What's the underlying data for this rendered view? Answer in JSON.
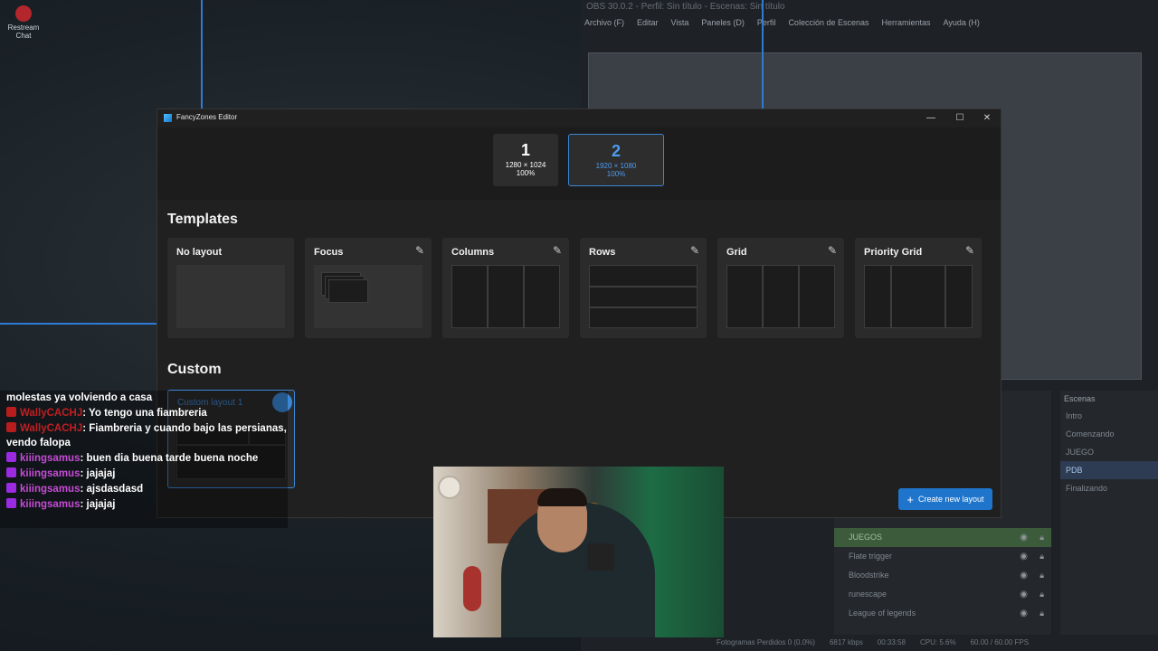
{
  "desktop": {
    "icon_label": "Restream Chat"
  },
  "obs": {
    "title": "OBS 30.0.2 - Perfil: Sin título - Escenas: Sin título",
    "menu": [
      "Archivo (F)",
      "Editar",
      "Vista",
      "Paneles (D)",
      "Perfil",
      "Colección de Escenas",
      "Herramientas",
      "Ayuda (H)"
    ],
    "sources": [
      "JUEGOS",
      "Flate trigger",
      "Bloodstrike",
      "runescape",
      "League of legends"
    ],
    "scenes_title": "Escenas",
    "scenes": [
      "Intro",
      "Comenzando",
      "JUEGO",
      "PDB",
      "Finalizando"
    ],
    "status": [
      "Fotogramas Perdidos 0 (0.0%)",
      "6817 kbps",
      "00:33:58",
      "CPU: 5.6%",
      "60.00 / 60.00 FPS"
    ]
  },
  "editor": {
    "title": "FancyZones Editor",
    "monitors": [
      {
        "number": "1",
        "resolution": "1280 × 1024",
        "scale": "100%"
      },
      {
        "number": "2",
        "resolution": "1920 × 1080",
        "scale": "100%"
      }
    ],
    "templates_heading": "Templates",
    "templates": [
      {
        "label": "No layout"
      },
      {
        "label": "Focus"
      },
      {
        "label": "Columns"
      },
      {
        "label": "Rows"
      },
      {
        "label": "Grid"
      },
      {
        "label": "Priority Grid"
      }
    ],
    "custom_heading": "Custom",
    "custom_layouts": [
      {
        "label": "Custom layout 1"
      }
    ],
    "create_button": "Create new layout"
  },
  "chat": [
    {
      "user": "",
      "text": "molestas ya volviendo a casa"
    },
    {
      "user": "WallyCACHJ",
      "text": ": Yo tengo una fiambreria"
    },
    {
      "user": "WallyCACHJ",
      "text": ": Fiambreria y cuando bajo las persianas, vendo falopa"
    },
    {
      "user": "kiiingsamus",
      "text": ": buen dia buena tarde buena noche"
    },
    {
      "user": "kiiingsamus",
      "text": ": jajajaj"
    },
    {
      "user": "kiiingsamus",
      "text": ": ajsdasdasd"
    },
    {
      "user": "kiiingsamus",
      "text": ": jajajaj"
    }
  ]
}
